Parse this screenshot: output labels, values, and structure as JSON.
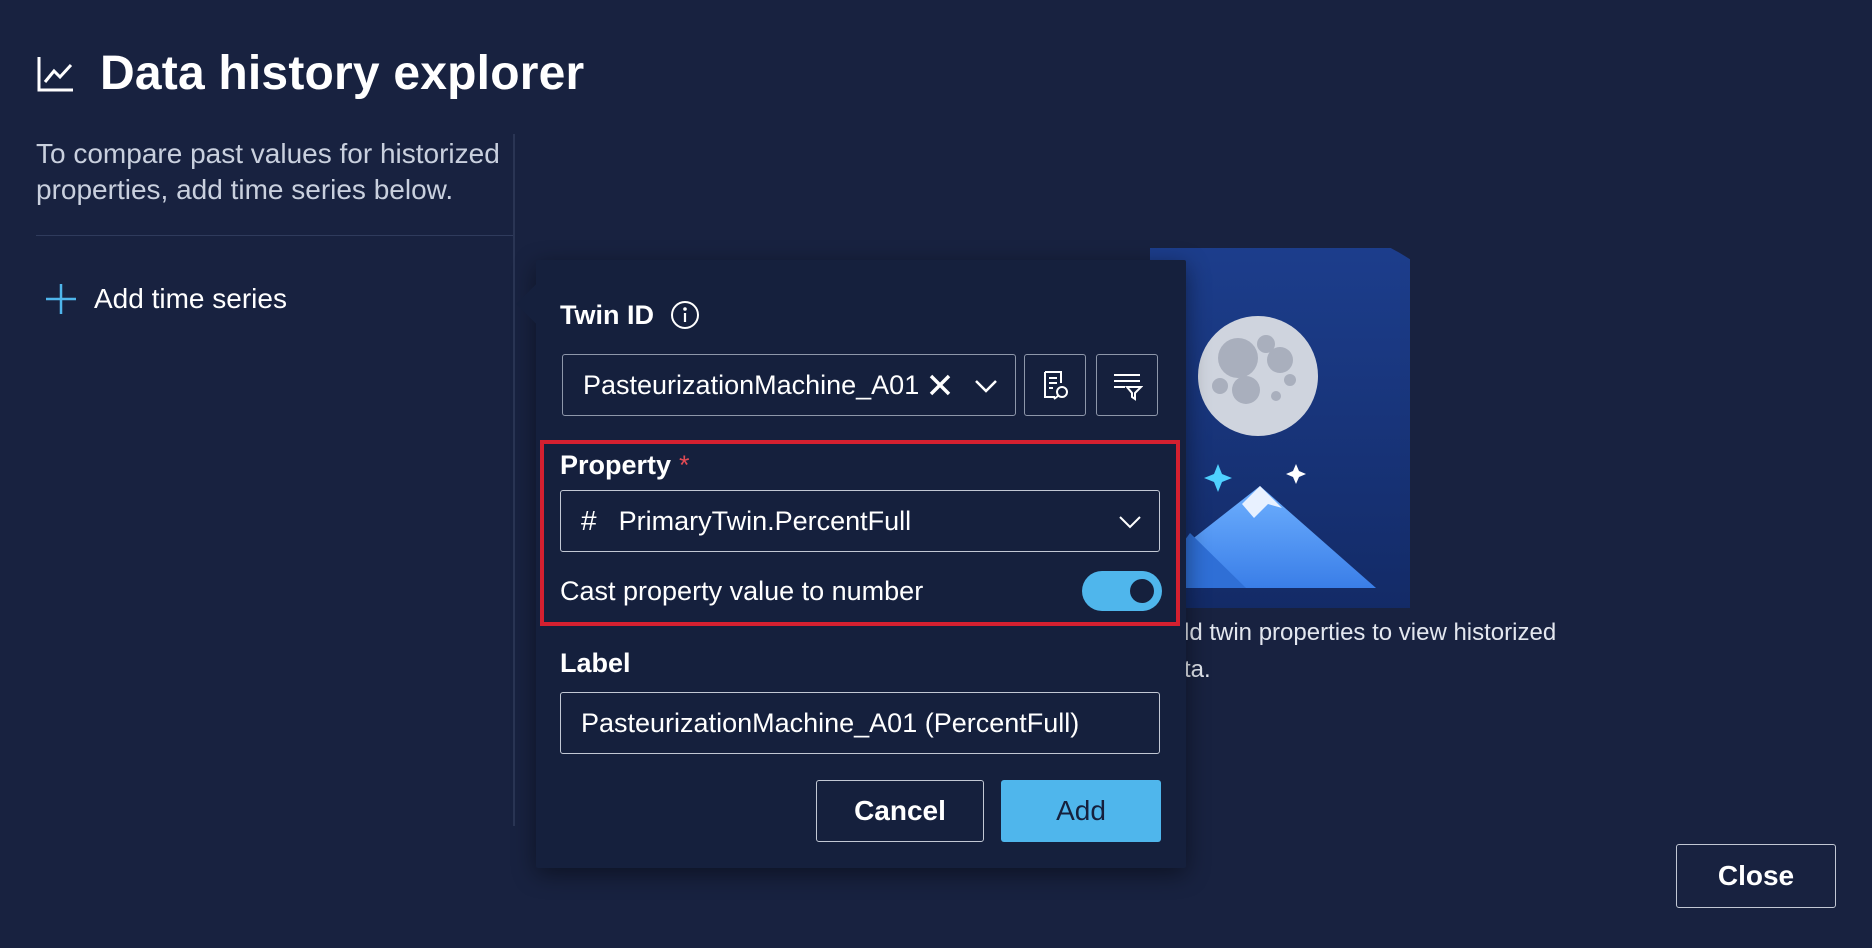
{
  "header": {
    "title": "Data history explorer",
    "icon": "chart-line-icon"
  },
  "left_panel": {
    "description": "To compare past values for historized properties, add time series below.",
    "add_series_label": "Add time series"
  },
  "empty_state": {
    "line1": "ld twin properties to view historized",
    "line2": "ta."
  },
  "popup": {
    "twin_id_label": "Twin ID",
    "twin_id_value": "PasteurizationMachine_A01",
    "property_label": "Property",
    "required_marker": "*",
    "property_hash": "#",
    "property_value": "PrimaryTwin.PercentFull",
    "cast_label": "Cast property value to number",
    "cast_enabled": true,
    "label_label": "Label",
    "label_value": "PasteurizationMachine_A01 (PercentFull)",
    "cancel_label": "Cancel",
    "add_label": "Add"
  },
  "footer": {
    "close_label": "Close"
  },
  "colors": {
    "background": "#182240",
    "popup": "#15203d",
    "accent": "#4fb6ec",
    "highlight": "#d42030"
  }
}
